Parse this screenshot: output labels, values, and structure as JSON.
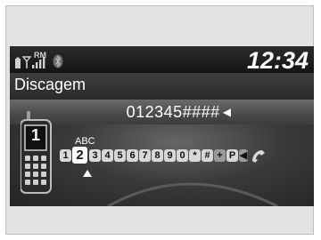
{
  "status": {
    "icons": [
      "battery-icon",
      "signal-icon",
      "roaming-icon",
      "bluetooth-icon"
    ],
    "roaming_label": "RM",
    "clock": "12:34"
  },
  "header": {
    "title": "Discagem"
  },
  "dial": {
    "number": "012345####"
  },
  "keypad": {
    "page_number": "1",
    "letters": "ABC",
    "keys": [
      "1",
      "2",
      "3",
      "4",
      "5",
      "6",
      "7",
      "8",
      "9",
      "0",
      "*",
      "#",
      "+",
      "P"
    ],
    "selected_key": "2",
    "call_icon": "handset-icon",
    "phone_icon": "cellphone-icon"
  }
}
